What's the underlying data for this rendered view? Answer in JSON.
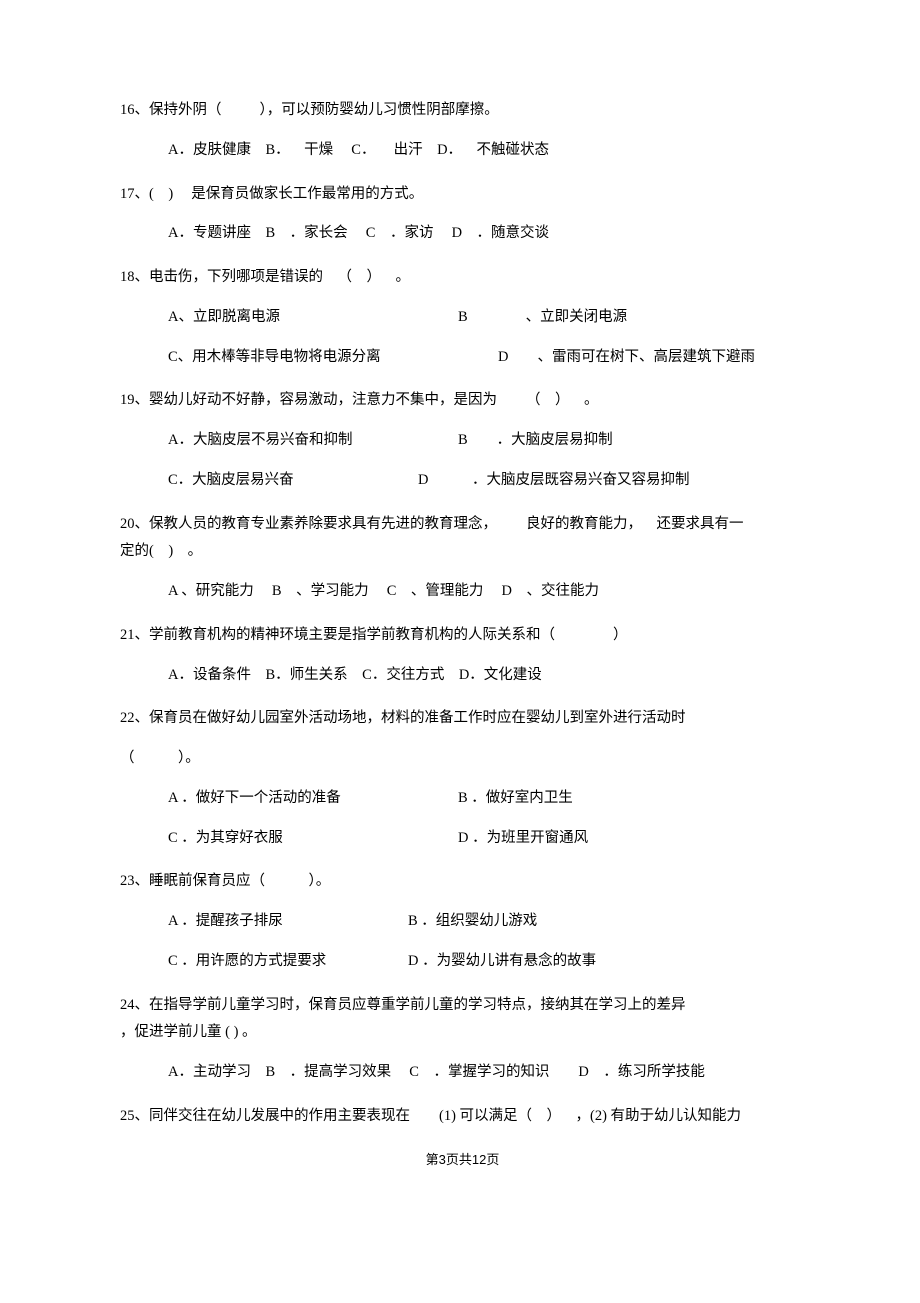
{
  "q16": {
    "stem_pre": "16、保持外阴（",
    "stem_post": "），可以预防婴幼儿习惯性阴部摩擦。",
    "opts": "A．皮肤健康 B． 干燥  C．  出汗 D． 不触碰状态"
  },
  "q17": {
    "stem_pre": "17、( )  是保育员做家长工作最常用的方式。",
    "opts": "A．专题讲座 B ．家长会  C ．家访  D ．随意交谈"
  },
  "q18": {
    "stem": "18、电击伤，下列哪项是错误的 （ ） 。",
    "row1_a": "A、立即脱离电源",
    "row1_b": "B    、立即关闭电源",
    "row2_a": "C、用木棒等非导电物将电源分离",
    "row2_b": "D  、雷雨可在树下、高层建筑下避雨"
  },
  "q19": {
    "stem": "19、婴幼儿好动不好静，容易激动，注意力不集中，是因为  （ ） 。",
    "row1_a": "A．大脑皮层不易兴奋和抑制",
    "row1_b": "B  ．大脑皮层易抑制",
    "row2_a": "C．大脑皮层易兴奋",
    "row2_b": "D   ．大脑皮层既容易兴奋又容易抑制"
  },
  "q20": {
    "stem1": "20、保教人员的教育专业素养除要求具有先进的教育理念，  良好的教育能力， 还要求具有一",
    "stem2": "定的( ) 。",
    "opts": "A 、研究能力  B 、学习能力  C 、管理能力  D 、交往能力"
  },
  "q21": {
    "stem": "21、学前教育机构的精神环境主要是指学前教育机构的人际关系和（    ）",
    "opts": "A．设备条件 B．师生关系 C．交往方式 D．文化建设"
  },
  "q22": {
    "stem1": "22、保育员在做好幼儿园室外活动场地，材料的准备工作时应在婴幼儿到室外进行活动时",
    "stem2": "（   ）。",
    "row1_a": "A ．做好下一个活动的准备",
    "row1_b": "B ．做好室内卫生",
    "row2_a": "C ．为其穿好衣服",
    "row2_b": "D ．为班里开窗通风"
  },
  "q23": {
    "stem": "23、睡眠前保育员应（   ）。",
    "row1_a": "A ．提醒孩子排尿",
    "row1_b": "B ．组织婴幼儿游戏",
    "row2_a": "C ．用许愿的方式提要求",
    "row2_b": "D ．为婴幼儿讲有悬念的故事"
  },
  "q24": {
    "stem1": "24、在指导学前儿童学习时，保育员应尊重学前儿童的学习特点，接纳其在学习上的差异",
    "stem2": "，促进学前儿童 ( ) 。",
    "opts": "A．主动学习 B ．提高学习效果  C ．掌握学习的知识  D ．练习所学技能"
  },
  "q25": {
    "stem": "25、同伴交往在幼儿发展中的作用主要表现在  (1) 可以满足（ ） ，(2) 有助于幼儿认知能力"
  },
  "footer": "第3页共12页"
}
